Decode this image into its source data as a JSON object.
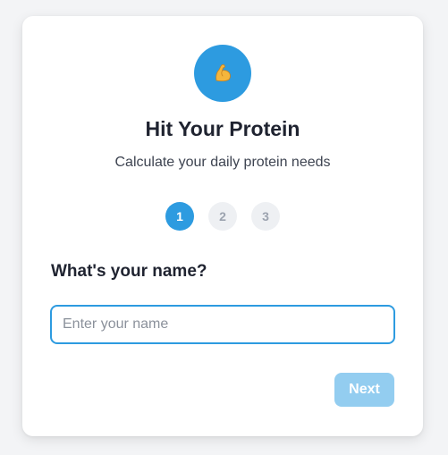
{
  "app": {
    "icon": "flexed-biceps-icon",
    "title": "Hit Your Protein",
    "subtitle": "Calculate your daily protein needs"
  },
  "steps": {
    "items": [
      "1",
      "2",
      "3"
    ],
    "current": 1
  },
  "form": {
    "question": "What's your name?",
    "name_value": "",
    "name_placeholder": "Enter your name"
  },
  "actions": {
    "next_label": "Next",
    "next_enabled": false
  },
  "colors": {
    "accent": "#2d9be0",
    "accent_disabled": "#93cdf0",
    "step_inactive_bg": "#eef0f3"
  }
}
